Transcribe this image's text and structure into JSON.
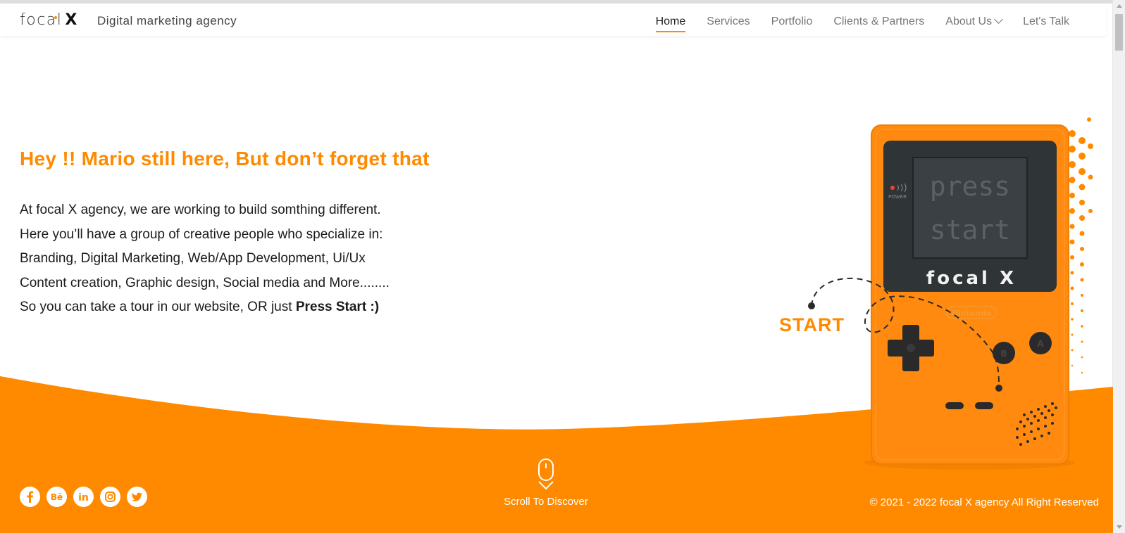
{
  "header": {
    "logo_text": "focal",
    "logo_x": "X",
    "tagline": "Digital marketing agency",
    "nav": [
      {
        "label": "Home",
        "active": true
      },
      {
        "label": "Services"
      },
      {
        "label": "Portfolio"
      },
      {
        "label": "Clients & Partners"
      },
      {
        "label": "About Us",
        "has_dropdown": true
      },
      {
        "label": "Let's Talk"
      }
    ]
  },
  "hero": {
    "headline": "Hey !! Mario still here, But don’t forget that",
    "lines": [
      "At focal X agency, we are working to build somthing different.",
      "Here you’ll have a group of creative people who specialize in:",
      "Branding, Digital Marketing, Web/App Development, Ui/Ux",
      "Content creation, Graphic design, Social media and More........"
    ],
    "last_line_prefix": "So you can take a tour in our website, OR just ",
    "last_line_bold": "Press Start :)"
  },
  "console": {
    "screen_line1": "press",
    "screen_line2": "start",
    "brand": "focal X",
    "power_label": "POWER",
    "maker_label": "Nintendo",
    "btn_a": "A",
    "btn_b": "B",
    "start_label": "START"
  },
  "footer": {
    "socials": [
      "facebook-icon",
      "behance-icon",
      "linkedin-icon",
      "instagram-icon",
      "twitter-icon"
    ],
    "scroll_label": "Scroll To Discover",
    "copyright": "© 2021 - 2022 focal X agency All Right Reserved"
  },
  "colors": {
    "accent": "#ff8a00",
    "console_body": "#ff8a0f",
    "screen": "#2f3436"
  }
}
